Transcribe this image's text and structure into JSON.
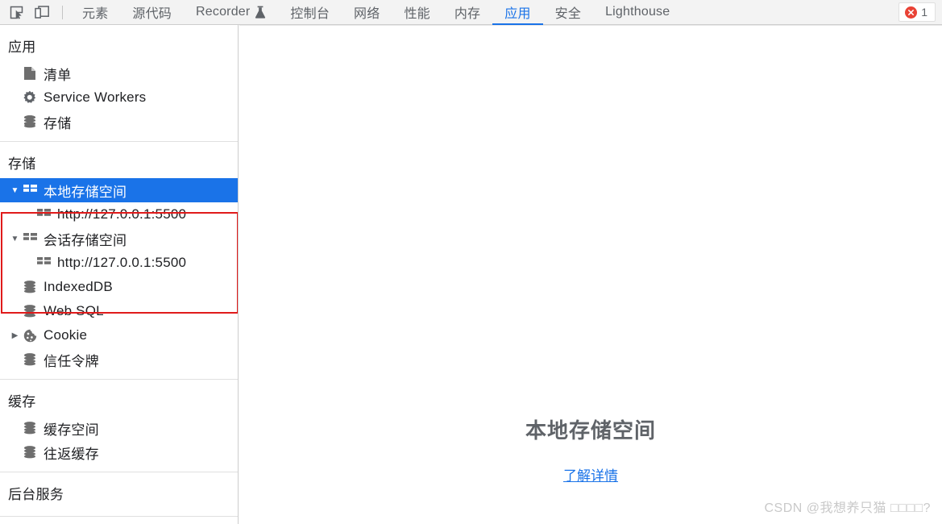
{
  "toolbar": {
    "inspect_icon": "inspect-element-icon",
    "device_icon": "device-toolbar-icon",
    "tabs": [
      {
        "label": "元素",
        "name": "tab-elements",
        "active": false,
        "flask": false
      },
      {
        "label": "源代码",
        "name": "tab-sources",
        "active": false,
        "flask": false
      },
      {
        "label": "Recorder",
        "name": "tab-recorder",
        "active": false,
        "flask": true
      },
      {
        "label": "控制台",
        "name": "tab-console",
        "active": false,
        "flask": false
      },
      {
        "label": "网络",
        "name": "tab-network",
        "active": false,
        "flask": false
      },
      {
        "label": "性能",
        "name": "tab-performance",
        "active": false,
        "flask": false
      },
      {
        "label": "内存",
        "name": "tab-memory",
        "active": false,
        "flask": false
      },
      {
        "label": "应用",
        "name": "tab-application",
        "active": true,
        "flask": false
      },
      {
        "label": "安全",
        "name": "tab-security",
        "active": false,
        "flask": false
      },
      {
        "label": "Lighthouse",
        "name": "tab-lighthouse",
        "active": false,
        "flask": false
      }
    ],
    "error_count": "1",
    "active_tab_color": "#1a73e8",
    "error_color": "#e94235"
  },
  "sidebar": {
    "groups": [
      {
        "title": "应用",
        "name": "sidebar-group-application",
        "items": [
          {
            "label": "清单",
            "name": "sidebar-item-manifest",
            "icon": "document-icon",
            "indent": 1,
            "twisty": "",
            "selected": false
          },
          {
            "label": "Service Workers",
            "name": "sidebar-item-service-workers",
            "icon": "gear-icon",
            "indent": 1,
            "twisty": "",
            "selected": false
          },
          {
            "label": "存储",
            "name": "sidebar-item-storage-overview",
            "icon": "database-icon",
            "indent": 1,
            "twisty": "",
            "selected": false
          }
        ]
      },
      {
        "title": "存储",
        "name": "sidebar-group-storage",
        "items": [
          {
            "label": "本地存储空间",
            "name": "sidebar-item-local-storage",
            "icon": "table-icon",
            "indent": 0,
            "twisty": "down",
            "selected": true
          },
          {
            "label": "http://127.0.0.1:5500",
            "name": "sidebar-item-local-storage-origin",
            "icon": "table-icon",
            "indent": 2,
            "twisty": "",
            "selected": false
          },
          {
            "label": "会话存储空间",
            "name": "sidebar-item-session-storage",
            "icon": "table-icon",
            "indent": 0,
            "twisty": "down",
            "selected": false
          },
          {
            "label": "http://127.0.0.1:5500",
            "name": "sidebar-item-session-storage-origin",
            "icon": "table-icon",
            "indent": 2,
            "twisty": "",
            "selected": false
          },
          {
            "label": "IndexedDB",
            "name": "sidebar-item-indexeddb",
            "icon": "database-icon",
            "indent": 1,
            "twisty": "",
            "selected": false
          },
          {
            "label": "Web SQL",
            "name": "sidebar-item-web-sql",
            "icon": "database-icon",
            "indent": 1,
            "twisty": "",
            "selected": false
          },
          {
            "label": "Cookie",
            "name": "sidebar-item-cookie",
            "icon": "cookie-icon",
            "indent": 0,
            "twisty": "right",
            "selected": false
          },
          {
            "label": "信任令牌",
            "name": "sidebar-item-trust-tokens",
            "icon": "database-icon",
            "indent": 1,
            "twisty": "",
            "selected": false
          }
        ]
      },
      {
        "title": "缓存",
        "name": "sidebar-group-cache",
        "items": [
          {
            "label": "缓存空间",
            "name": "sidebar-item-cache-storage",
            "icon": "database-icon",
            "indent": 1,
            "twisty": "",
            "selected": false
          },
          {
            "label": "往返缓存",
            "name": "sidebar-item-back-forward-cache",
            "icon": "database-icon",
            "indent": 1,
            "twisty": "",
            "selected": false
          }
        ]
      },
      {
        "title": "后台服务",
        "name": "sidebar-group-background-services",
        "items": []
      }
    ]
  },
  "main": {
    "empty_title": "本地存储空间",
    "empty_link": "了解详情",
    "link_color": "#1a73e8"
  },
  "annotation": {
    "box_color": "#e01b1b"
  },
  "watermark": {
    "text": "CSDN @我想养只猫 □□□□?"
  }
}
